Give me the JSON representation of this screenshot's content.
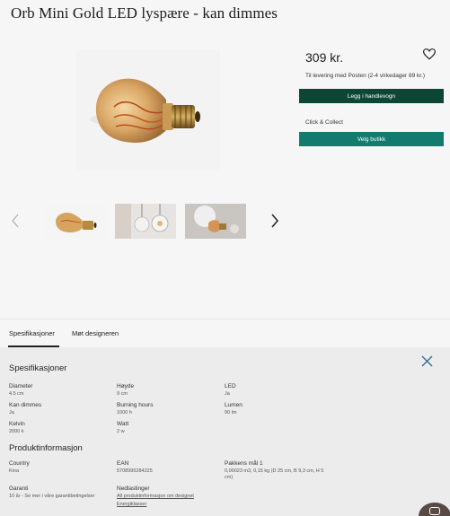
{
  "product": {
    "title": "Orb Mini Gold LED lyspære - kan dimmes",
    "price": "309 kr.",
    "delivery_text": "Til levering med Posten (2-4 virkedager 89 kr.)",
    "add_to_cart_label": "Legg i handlevogn",
    "click_collect_label": "Click & Collect",
    "choose_store_label": "Velg butikk"
  },
  "icons": {
    "favorite": "heart-icon",
    "prev": "chevron-left-icon",
    "next": "chevron-right-icon",
    "close": "close-icon",
    "chat": "chat-icon"
  },
  "colors": {
    "primary_button": "#0e4636",
    "secondary_button": "#137a6e"
  },
  "tabs": [
    {
      "label": "Spesifikasjoner",
      "active": true
    },
    {
      "label": "Møt designeren",
      "active": false
    }
  ],
  "specs": {
    "heading": "Spesifikasjoner",
    "items": [
      {
        "label": "Diameter",
        "value": "4.5 cm"
      },
      {
        "label": "Høyde",
        "value": "9 cm"
      },
      {
        "label": "LED",
        "value": "Ja"
      },
      {
        "label": "Kan dimmes",
        "value": "Ja"
      },
      {
        "label": "Burning hours",
        "value": "1000 h"
      },
      {
        "label": "Lumen",
        "value": "90 lm"
      },
      {
        "label": "Kelvin",
        "value": "2000 k"
      },
      {
        "label": "Watt",
        "value": "2 w"
      }
    ]
  },
  "product_info": {
    "heading": "Produktinformasjon",
    "country_label": "Country",
    "country_value": "Kina",
    "ean_label": "EAN",
    "ean_value": "5708995284225",
    "package_label": "Pakkens mål 1",
    "package_value": "0,00023 m3, 0,15 kg (D 25 cm, B 9,3 cm, H 5 cm)",
    "warranty_label": "Garanti",
    "warranty_value": "10 år - Se mer i våre garantibetingelser",
    "downloads_label": "Nedlastinger",
    "download_link_1": "All produktinformasjon om designet",
    "download_link_2": "Energiklasser"
  }
}
